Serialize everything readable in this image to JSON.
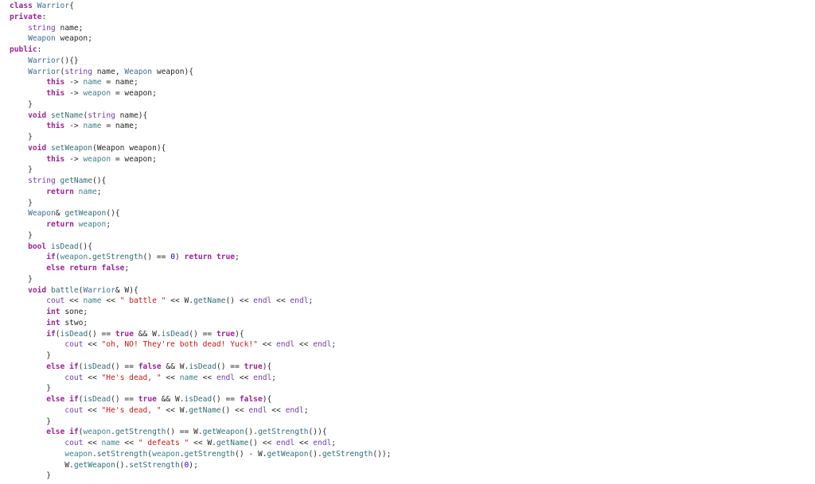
{
  "code_lines": [
    [
      {
        "t": "kw",
        "v": "class"
      },
      {
        "t": "pl",
        "v": " "
      },
      {
        "t": "cls",
        "v": "Warrior"
      },
      {
        "t": "pl",
        "v": "{"
      }
    ],
    [
      {
        "t": "kw",
        "v": "private"
      },
      {
        "t": "pl",
        "v": ":"
      }
    ],
    [
      {
        "t": "pl",
        "v": "    "
      },
      {
        "t": "ty",
        "v": "string"
      },
      {
        "t": "pl",
        "v": " name;"
      }
    ],
    [
      {
        "t": "pl",
        "v": "    "
      },
      {
        "t": "cls",
        "v": "Weapon"
      },
      {
        "t": "pl",
        "v": " weapon;"
      }
    ],
    [
      {
        "t": "kw",
        "v": "public"
      },
      {
        "t": "pl",
        "v": ":"
      }
    ],
    [
      {
        "t": "pl",
        "v": "    "
      },
      {
        "t": "cls",
        "v": "Warrior"
      },
      {
        "t": "pl",
        "v": "(){}"
      }
    ],
    [
      {
        "t": "pl",
        "v": "    "
      },
      {
        "t": "cls",
        "v": "Warrior"
      },
      {
        "t": "pl",
        "v": "("
      },
      {
        "t": "ty",
        "v": "string"
      },
      {
        "t": "pl",
        "v": " name, "
      },
      {
        "t": "cls",
        "v": "Weapon"
      },
      {
        "t": "pl",
        "v": " weapon){"
      }
    ],
    [
      {
        "t": "pl",
        "v": "        "
      },
      {
        "t": "kw",
        "v": "this"
      },
      {
        "t": "pl",
        "v": " -> "
      },
      {
        "t": "mem",
        "v": "name"
      },
      {
        "t": "pl",
        "v": " = name;"
      }
    ],
    [
      {
        "t": "pl",
        "v": "        "
      },
      {
        "t": "kw",
        "v": "this"
      },
      {
        "t": "pl",
        "v": " -> "
      },
      {
        "t": "mem",
        "v": "weapon"
      },
      {
        "t": "pl",
        "v": " = weapon;"
      }
    ],
    [
      {
        "t": "pl",
        "v": "    }"
      }
    ],
    [
      {
        "t": "pl",
        "v": "    "
      },
      {
        "t": "kw",
        "v": "void"
      },
      {
        "t": "pl",
        "v": " "
      },
      {
        "t": "fn",
        "v": "setName"
      },
      {
        "t": "pl",
        "v": "("
      },
      {
        "t": "ty",
        "v": "string"
      },
      {
        "t": "pl",
        "v": " name){"
      }
    ],
    [
      {
        "t": "pl",
        "v": "        "
      },
      {
        "t": "kw",
        "v": "this"
      },
      {
        "t": "pl",
        "v": " -> "
      },
      {
        "t": "mem",
        "v": "name"
      },
      {
        "t": "pl",
        "v": " = name;"
      }
    ],
    [
      {
        "t": "pl",
        "v": "    }"
      }
    ],
    [
      {
        "t": "pl",
        "v": "    "
      },
      {
        "t": "kw",
        "v": "void"
      },
      {
        "t": "pl",
        "v": " "
      },
      {
        "t": "fn",
        "v": "setWeapon"
      },
      {
        "t": "pl",
        "v": "(Weapon weapon){"
      }
    ],
    [
      {
        "t": "pl",
        "v": "        "
      },
      {
        "t": "kw",
        "v": "this"
      },
      {
        "t": "pl",
        "v": " -> "
      },
      {
        "t": "mem",
        "v": "weapon"
      },
      {
        "t": "pl",
        "v": " = weapon;"
      }
    ],
    [
      {
        "t": "pl",
        "v": "    }"
      }
    ],
    [
      {
        "t": "pl",
        "v": "    "
      },
      {
        "t": "ty",
        "v": "string"
      },
      {
        "t": "pl",
        "v": " "
      },
      {
        "t": "fn",
        "v": "getName"
      },
      {
        "t": "pl",
        "v": "(){"
      }
    ],
    [
      {
        "t": "pl",
        "v": "        "
      },
      {
        "t": "kw",
        "v": "return"
      },
      {
        "t": "pl",
        "v": " "
      },
      {
        "t": "mem",
        "v": "name"
      },
      {
        "t": "pl",
        "v": ";"
      }
    ],
    [
      {
        "t": "pl",
        "v": "    }"
      }
    ],
    [
      {
        "t": "pl",
        "v": "    "
      },
      {
        "t": "cls",
        "v": "Weapon"
      },
      {
        "t": "pl",
        "v": "& "
      },
      {
        "t": "fn",
        "v": "getWeapon"
      },
      {
        "t": "pl",
        "v": "(){"
      }
    ],
    [
      {
        "t": "pl",
        "v": "        "
      },
      {
        "t": "kw",
        "v": "return"
      },
      {
        "t": "pl",
        "v": " "
      },
      {
        "t": "mem",
        "v": "weapon"
      },
      {
        "t": "pl",
        "v": ";"
      }
    ],
    [
      {
        "t": "pl",
        "v": "    }"
      }
    ],
    [
      {
        "t": "pl",
        "v": "    "
      },
      {
        "t": "kw",
        "v": "bool"
      },
      {
        "t": "pl",
        "v": " "
      },
      {
        "t": "fn",
        "v": "isDead"
      },
      {
        "t": "pl",
        "v": "(){"
      }
    ],
    [
      {
        "t": "pl",
        "v": "        "
      },
      {
        "t": "kw",
        "v": "if"
      },
      {
        "t": "pl",
        "v": "("
      },
      {
        "t": "mem",
        "v": "weapon"
      },
      {
        "t": "pl",
        "v": "."
      },
      {
        "t": "fn",
        "v": "getStrength"
      },
      {
        "t": "pl",
        "v": "() == "
      },
      {
        "t": "num",
        "v": "0"
      },
      {
        "t": "pl",
        "v": ") "
      },
      {
        "t": "kw",
        "v": "return"
      },
      {
        "t": "pl",
        "v": " "
      },
      {
        "t": "kw",
        "v": "true"
      },
      {
        "t": "pl",
        "v": ";"
      }
    ],
    [
      {
        "t": "pl",
        "v": "        "
      },
      {
        "t": "kw",
        "v": "else"
      },
      {
        "t": "pl",
        "v": " "
      },
      {
        "t": "kw",
        "v": "return"
      },
      {
        "t": "pl",
        "v": " "
      },
      {
        "t": "kw",
        "v": "false"
      },
      {
        "t": "pl",
        "v": ";"
      }
    ],
    [
      {
        "t": "pl",
        "v": "    }"
      }
    ],
    [
      {
        "t": "pl",
        "v": "    "
      },
      {
        "t": "kw",
        "v": "void"
      },
      {
        "t": "pl",
        "v": " "
      },
      {
        "t": "fn",
        "v": "battle"
      },
      {
        "t": "pl",
        "v": "("
      },
      {
        "t": "cls",
        "v": "Warrior"
      },
      {
        "t": "pl",
        "v": "& W){"
      }
    ],
    [
      {
        "t": "pl",
        "v": "        "
      },
      {
        "t": "ty",
        "v": "cout"
      },
      {
        "t": "pl",
        "v": " << "
      },
      {
        "t": "mem",
        "v": "name"
      },
      {
        "t": "pl",
        "v": " << "
      },
      {
        "t": "str",
        "v": "\" battle \""
      },
      {
        "t": "pl",
        "v": " << W."
      },
      {
        "t": "fn",
        "v": "getName"
      },
      {
        "t": "pl",
        "v": "() << "
      },
      {
        "t": "ty",
        "v": "endl"
      },
      {
        "t": "pl",
        "v": " << "
      },
      {
        "t": "ty",
        "v": "endl"
      },
      {
        "t": "pl",
        "v": ";"
      }
    ],
    [
      {
        "t": "pl",
        "v": "        "
      },
      {
        "t": "kw",
        "v": "int"
      },
      {
        "t": "pl",
        "v": " sone;"
      }
    ],
    [
      {
        "t": "pl",
        "v": "        "
      },
      {
        "t": "kw",
        "v": "int"
      },
      {
        "t": "pl",
        "v": " stwo;"
      }
    ],
    [
      {
        "t": "pl",
        "v": "        "
      },
      {
        "t": "kw",
        "v": "if"
      },
      {
        "t": "pl",
        "v": "("
      },
      {
        "t": "fn",
        "v": "isDead"
      },
      {
        "t": "pl",
        "v": "() == "
      },
      {
        "t": "kw",
        "v": "true"
      },
      {
        "t": "pl",
        "v": " && W."
      },
      {
        "t": "fn",
        "v": "isDead"
      },
      {
        "t": "pl",
        "v": "() == "
      },
      {
        "t": "kw",
        "v": "true"
      },
      {
        "t": "pl",
        "v": "){"
      }
    ],
    [
      {
        "t": "pl",
        "v": "            "
      },
      {
        "t": "ty",
        "v": "cout"
      },
      {
        "t": "pl",
        "v": " << "
      },
      {
        "t": "str",
        "v": "\"oh, NO! They're both dead! Yuck!\""
      },
      {
        "t": "pl",
        "v": " << "
      },
      {
        "t": "ty",
        "v": "endl"
      },
      {
        "t": "pl",
        "v": " << "
      },
      {
        "t": "ty",
        "v": "endl"
      },
      {
        "t": "pl",
        "v": ";"
      }
    ],
    [
      {
        "t": "pl",
        "v": "        }"
      }
    ],
    [
      {
        "t": "pl",
        "v": "        "
      },
      {
        "t": "kw",
        "v": "else"
      },
      {
        "t": "pl",
        "v": " "
      },
      {
        "t": "kw",
        "v": "if"
      },
      {
        "t": "pl",
        "v": "("
      },
      {
        "t": "fn",
        "v": "isDead"
      },
      {
        "t": "pl",
        "v": "() == "
      },
      {
        "t": "kw",
        "v": "false"
      },
      {
        "t": "pl",
        "v": " && W."
      },
      {
        "t": "fn",
        "v": "isDead"
      },
      {
        "t": "pl",
        "v": "() == "
      },
      {
        "t": "kw",
        "v": "true"
      },
      {
        "t": "pl",
        "v": "){"
      }
    ],
    [
      {
        "t": "pl",
        "v": "            "
      },
      {
        "t": "ty",
        "v": "cout"
      },
      {
        "t": "pl",
        "v": " << "
      },
      {
        "t": "str",
        "v": "\"He's dead, \""
      },
      {
        "t": "pl",
        "v": " << "
      },
      {
        "t": "mem",
        "v": "name"
      },
      {
        "t": "pl",
        "v": " << "
      },
      {
        "t": "ty",
        "v": "endl"
      },
      {
        "t": "pl",
        "v": " << "
      },
      {
        "t": "ty",
        "v": "endl"
      },
      {
        "t": "pl",
        "v": ";"
      }
    ],
    [
      {
        "t": "pl",
        "v": "        }"
      }
    ],
    [
      {
        "t": "pl",
        "v": "        "
      },
      {
        "t": "kw",
        "v": "else"
      },
      {
        "t": "pl",
        "v": " "
      },
      {
        "t": "kw",
        "v": "if"
      },
      {
        "t": "pl",
        "v": "("
      },
      {
        "t": "fn",
        "v": "isDead"
      },
      {
        "t": "pl",
        "v": "() == "
      },
      {
        "t": "kw",
        "v": "true"
      },
      {
        "t": "pl",
        "v": " && W."
      },
      {
        "t": "fn",
        "v": "isDead"
      },
      {
        "t": "pl",
        "v": "() == "
      },
      {
        "t": "kw",
        "v": "false"
      },
      {
        "t": "pl",
        "v": "){"
      }
    ],
    [
      {
        "t": "pl",
        "v": "            "
      },
      {
        "t": "ty",
        "v": "cout"
      },
      {
        "t": "pl",
        "v": " << "
      },
      {
        "t": "str",
        "v": "\"He's dead, \""
      },
      {
        "t": "pl",
        "v": " << W."
      },
      {
        "t": "fn",
        "v": "getName"
      },
      {
        "t": "pl",
        "v": "() << "
      },
      {
        "t": "ty",
        "v": "endl"
      },
      {
        "t": "pl",
        "v": " << "
      },
      {
        "t": "ty",
        "v": "endl"
      },
      {
        "t": "pl",
        "v": ";"
      }
    ],
    [
      {
        "t": "pl",
        "v": "        }"
      }
    ],
    [
      {
        "t": "pl",
        "v": "        "
      },
      {
        "t": "kw",
        "v": "else"
      },
      {
        "t": "pl",
        "v": " "
      },
      {
        "t": "kw",
        "v": "if"
      },
      {
        "t": "pl",
        "v": "("
      },
      {
        "t": "mem",
        "v": "weapon"
      },
      {
        "t": "pl",
        "v": "."
      },
      {
        "t": "fn",
        "v": "getStrength"
      },
      {
        "t": "pl",
        "v": "() == W."
      },
      {
        "t": "fn",
        "v": "getWeapon"
      },
      {
        "t": "pl",
        "v": "()."
      },
      {
        "t": "fn",
        "v": "getStrength"
      },
      {
        "t": "pl",
        "v": "()){"
      }
    ],
    [
      {
        "t": "pl",
        "v": "            "
      },
      {
        "t": "ty",
        "v": "cout"
      },
      {
        "t": "pl",
        "v": " << "
      },
      {
        "t": "mem",
        "v": "name"
      },
      {
        "t": "pl",
        "v": " << "
      },
      {
        "t": "str",
        "v": "\" defeats \""
      },
      {
        "t": "pl",
        "v": " << W."
      },
      {
        "t": "fn",
        "v": "getName"
      },
      {
        "t": "pl",
        "v": "() << "
      },
      {
        "t": "ty",
        "v": "endl"
      },
      {
        "t": "pl",
        "v": " << "
      },
      {
        "t": "ty",
        "v": "endl"
      },
      {
        "t": "pl",
        "v": ";"
      }
    ],
    [
      {
        "t": "pl",
        "v": "            "
      },
      {
        "t": "mem",
        "v": "weapon"
      },
      {
        "t": "pl",
        "v": "."
      },
      {
        "t": "fn",
        "v": "setStrength"
      },
      {
        "t": "pl",
        "v": "("
      },
      {
        "t": "mem",
        "v": "weapon"
      },
      {
        "t": "pl",
        "v": "."
      },
      {
        "t": "fn",
        "v": "getStrength"
      },
      {
        "t": "pl",
        "v": "() - W."
      },
      {
        "t": "fn",
        "v": "getWeapon"
      },
      {
        "t": "pl",
        "v": "()."
      },
      {
        "t": "fn",
        "v": "getStrength"
      },
      {
        "t": "pl",
        "v": "());"
      }
    ],
    [
      {
        "t": "pl",
        "v": "            W."
      },
      {
        "t": "fn",
        "v": "getWeapon"
      },
      {
        "t": "pl",
        "v": "()."
      },
      {
        "t": "fn",
        "v": "setStrength"
      },
      {
        "t": "pl",
        "v": "("
      },
      {
        "t": "num",
        "v": "0"
      },
      {
        "t": "pl",
        "v": ");"
      }
    ],
    [
      {
        "t": "pl",
        "v": "        }"
      }
    ]
  ]
}
